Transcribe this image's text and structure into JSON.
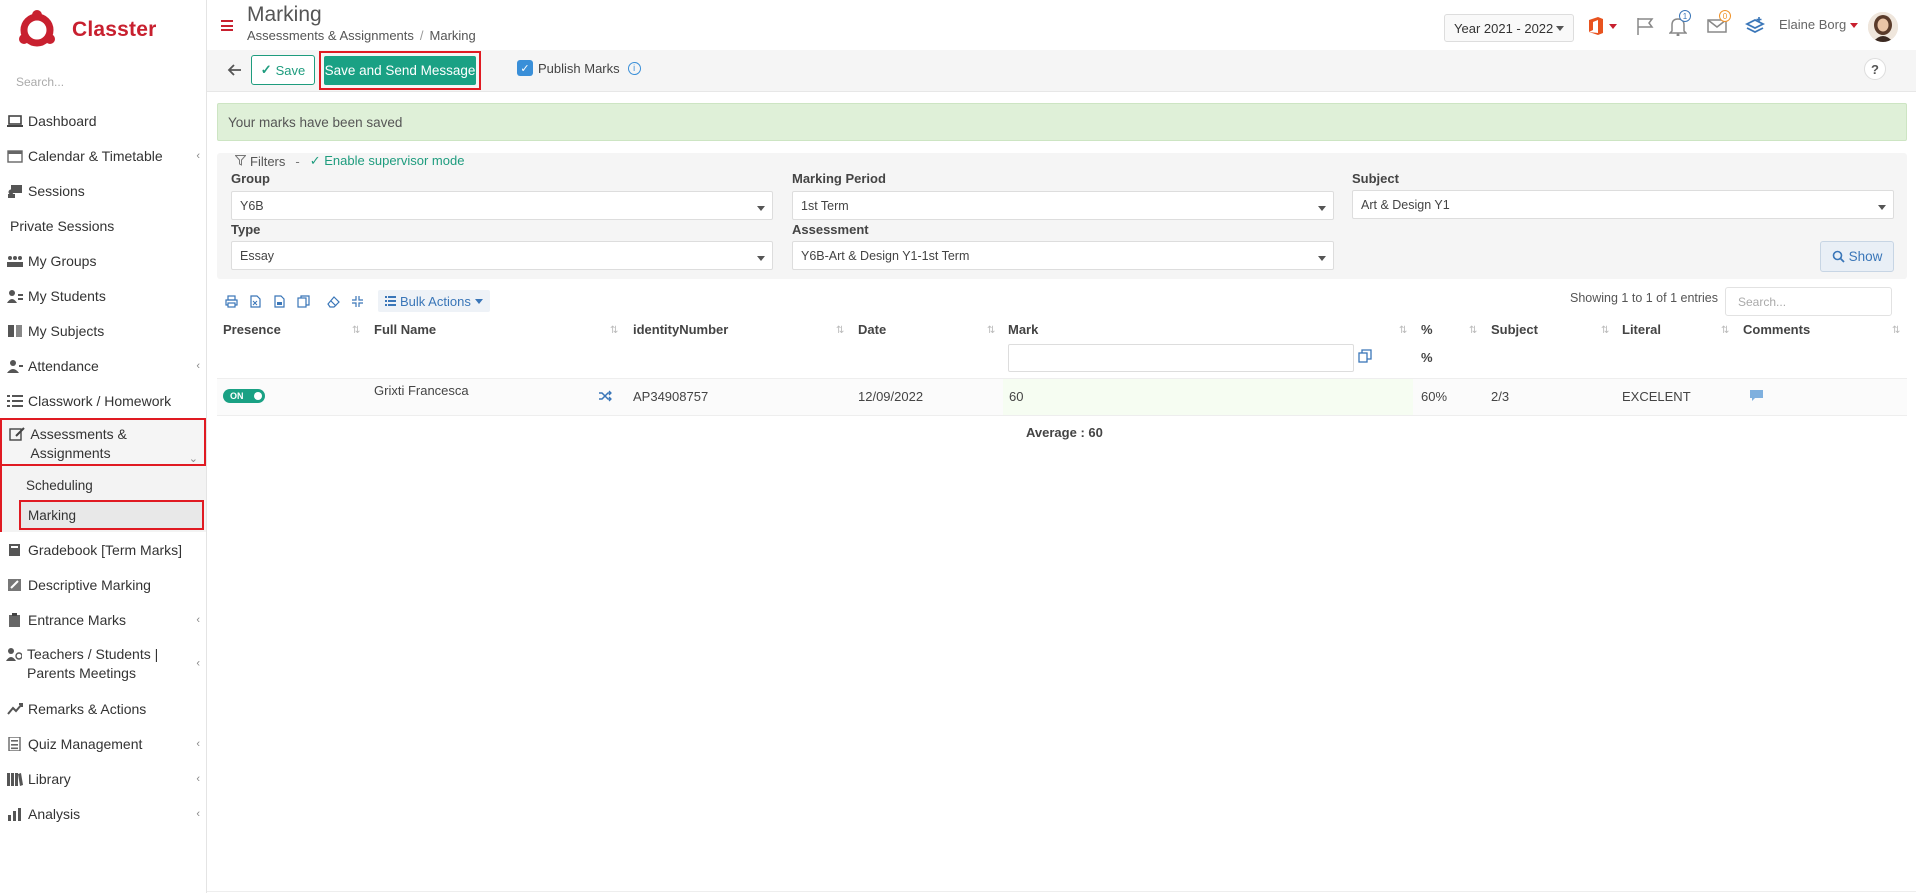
{
  "brand": {
    "name": "Classter",
    "color": "#c8202f"
  },
  "sidebar": {
    "search_placeholder": "Search...",
    "items": [
      {
        "label": "Dashboard",
        "icon": "laptop-icon"
      },
      {
        "label": "Calendar & Timetable",
        "icon": "calendar-icon",
        "has_chevron": true
      },
      {
        "label": "Sessions",
        "icon": "sessions-icon"
      },
      {
        "label": "Private Sessions"
      },
      {
        "label": "My Groups",
        "icon": "groups-icon"
      },
      {
        "label": "My Students",
        "icon": "students-icon"
      },
      {
        "label": "My Subjects",
        "icon": "book-icon"
      },
      {
        "label": "Attendance",
        "icon": "attendance-icon",
        "has_chevron": true
      },
      {
        "label": "Classwork / Homework",
        "icon": "list-icon"
      },
      {
        "label": "Assessments & Assignments",
        "icon": "edit-icon",
        "expanded": true
      },
      {
        "label": "Gradebook [Term Marks]",
        "icon": "gradebook-icon"
      },
      {
        "label": "Descriptive Marking",
        "icon": "descriptive-icon"
      },
      {
        "label": "Entrance Marks",
        "icon": "clipboard-icon",
        "has_chevron": true
      },
      {
        "label": "Teachers / Students | Parents Meetings",
        "icon": "meeting-icon",
        "has_chevron": true
      },
      {
        "label": "Remarks & Actions",
        "icon": "remarks-icon"
      },
      {
        "label": "Quiz Management",
        "icon": "quiz-icon",
        "has_chevron": true
      },
      {
        "label": "Library",
        "icon": "library-icon",
        "has_chevron": true
      },
      {
        "label": "Analysis",
        "icon": "chart-icon",
        "has_chevron": true
      }
    ],
    "sub_items": [
      {
        "label": "Scheduling"
      },
      {
        "label": "Marking",
        "current": true
      }
    ]
  },
  "header": {
    "title": "Marking",
    "breadcrumb": [
      "Assessments & Assignments",
      "Marking"
    ],
    "year": "Year 2021 - 2022",
    "notifications_count": "1",
    "messages_count": "0",
    "user_name": "Elaine Borg"
  },
  "toolbar": {
    "save_label": "Save",
    "send_label": "Save and Send Message",
    "publish_label": "Publish Marks",
    "publish_checked": true,
    "help_label": "?"
  },
  "alert": {
    "text": "Your marks have been saved",
    "color": "#dff0d8"
  },
  "filters": {
    "title": "Filters",
    "supervisor_label": "Enable supervisor mode",
    "group_label": "Group",
    "group_value": "Y6B",
    "period_label": "Marking Period",
    "period_value": "1st Term",
    "subject_label": "Subject",
    "subject_value": "Art & Design Y1",
    "type_label": "Type",
    "type_value": "Essay",
    "assessment_label": "Assessment",
    "assessment_value": "Y6B-Art & Design Y1-1st Term",
    "show_label": "Show"
  },
  "table": {
    "bulk_label": "Bulk Actions",
    "showing_text": "Showing 1 to 1 of 1 entries",
    "search_placeholder": "Search...",
    "headers": [
      "Presence",
      "Full Name",
      "identityNumber",
      "Date",
      "Mark",
      "%",
      "Subject",
      "Literal",
      "Comments"
    ],
    "sub_header_pct": "%",
    "rows": [
      {
        "presence": "ON",
        "full_name": "Grixti Francesca",
        "identity": "AP34908757",
        "date": "12/09/2022",
        "mark": "60",
        "pct": "60%",
        "subject": "2/3",
        "literal": "EXCELENT"
      }
    ],
    "average_text": "Average : 60"
  },
  "colors": {
    "accent": "#1aa184",
    "link": "#3a76b8",
    "highlight": "#e01a22"
  }
}
